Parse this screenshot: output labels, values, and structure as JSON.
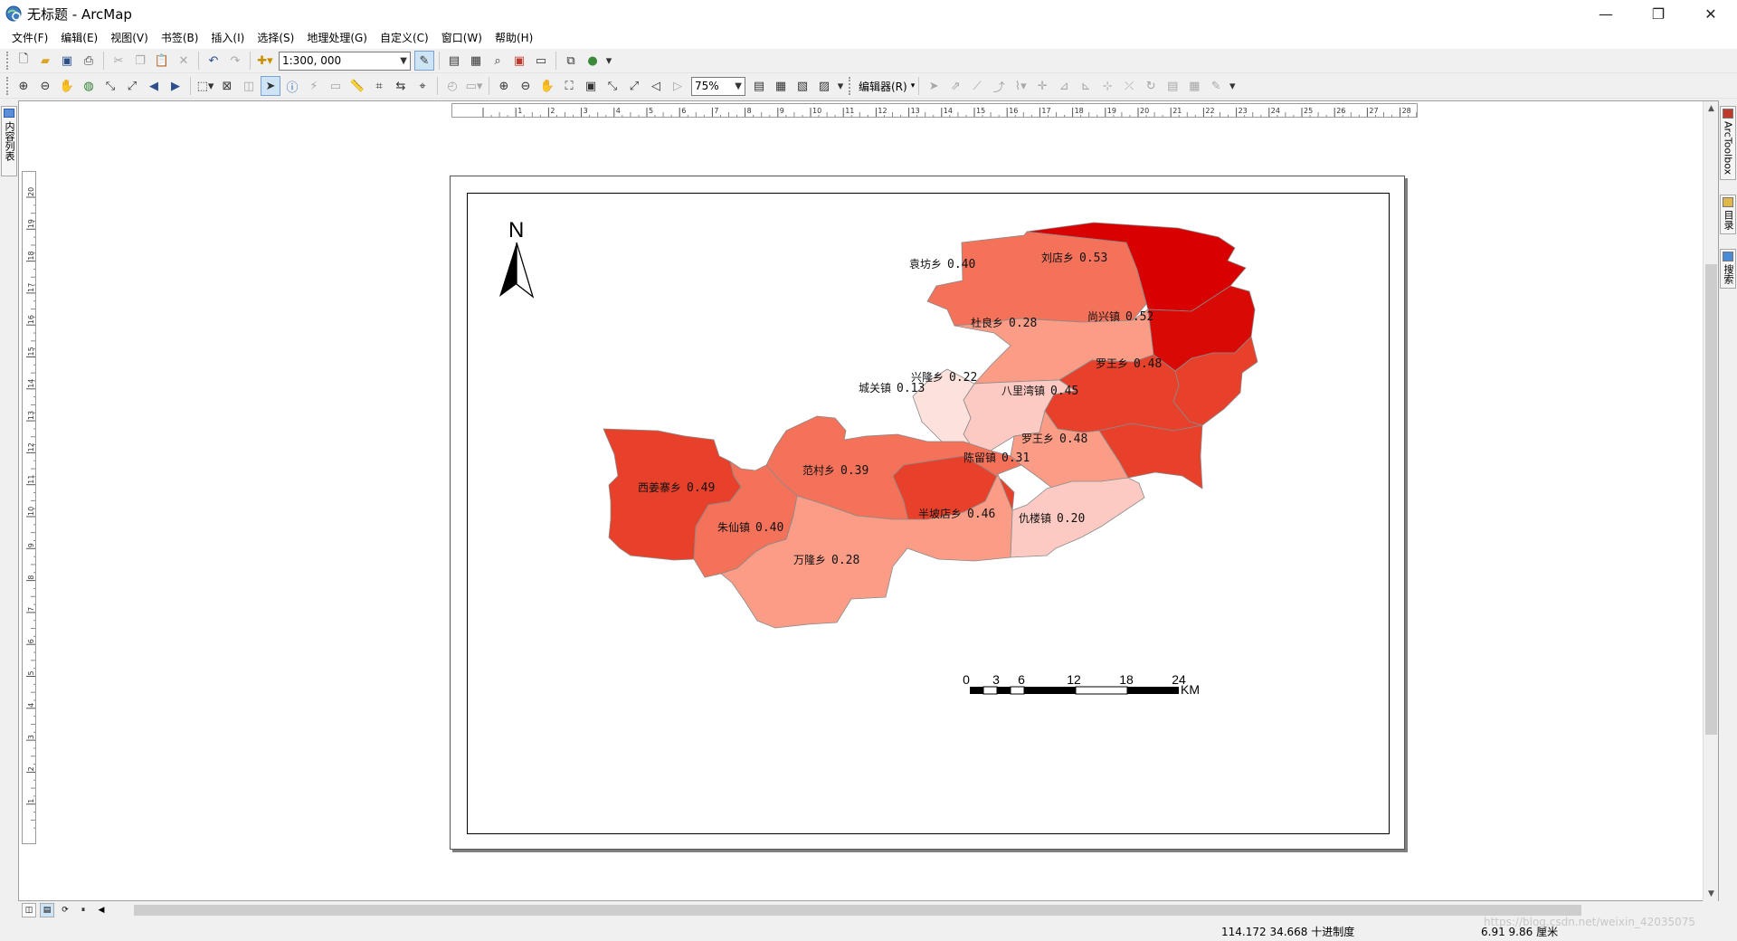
{
  "window": {
    "title": "无标题 - ArcMap",
    "controls": [
      "—",
      "❐",
      "✕"
    ]
  },
  "menu": [
    "文件(F)",
    "编辑(E)",
    "视图(V)",
    "书签(B)",
    "插入(I)",
    "选择(S)",
    "地理处理(G)",
    "自定义(C)",
    "窗口(W)",
    "帮助(H)"
  ],
  "toolbar": {
    "scale_value": "1:300, 000",
    "zoom_value": "75%",
    "editor_label": "编辑器(R)"
  },
  "dock": {
    "left_tab": "内容列表",
    "right_tabs": [
      "ArcToolbox",
      "目录",
      "搜索"
    ]
  },
  "map": {
    "north_label": "N",
    "scalebar": {
      "ticks": [
        "0",
        "3",
        "6",
        "12",
        "18",
        "24"
      ],
      "unit": "KM"
    },
    "regions": [
      {
        "name": "袁坊乡",
        "value": "0.40",
        "color": "#f4715a"
      },
      {
        "name": "刘店乡",
        "value": "0.53",
        "color": "#d80000"
      },
      {
        "name": "尚兴镇",
        "value": "0.52",
        "color": "#d90a05"
      },
      {
        "name": "杜良乡",
        "value": "0.28",
        "color": "#fb9c86"
      },
      {
        "name": "罗王乡",
        "value": "0.48",
        "color": "#e8412b"
      },
      {
        "name": "兴隆乡",
        "value": "0.22",
        "color": "#fccac2"
      },
      {
        "name": "城关镇",
        "value": "0.13",
        "color": "#fde1dc"
      },
      {
        "name": "八里湾镇",
        "value": "0.45",
        "color": "#e8412b"
      },
      {
        "name": "罗王乡",
        "value": "0.48",
        "color": "#e8412b"
      },
      {
        "name": "陈留镇",
        "value": "0.31",
        "color": "#fb9c86"
      },
      {
        "name": "范村乡",
        "value": "0.39",
        "color": "#f4715a"
      },
      {
        "name": "西姜寨乡",
        "value": "0.49",
        "color": "#e8412b"
      },
      {
        "name": "半坡店乡",
        "value": "0.46",
        "color": "#e8412b"
      },
      {
        "name": "仇楼镇",
        "value": "0.20",
        "color": "#fccac2"
      },
      {
        "name": "朱仙镇",
        "value": "0.40",
        "color": "#f4715a"
      },
      {
        "name": "万隆乡",
        "value": "0.28",
        "color": "#fb9c86"
      }
    ]
  },
  "status": {
    "coords": "114.172  34.668 十进制度",
    "page_pos": "6.91  9.86 厘米",
    "watermark": "https://blog.csdn.net/weixin_42035075"
  }
}
